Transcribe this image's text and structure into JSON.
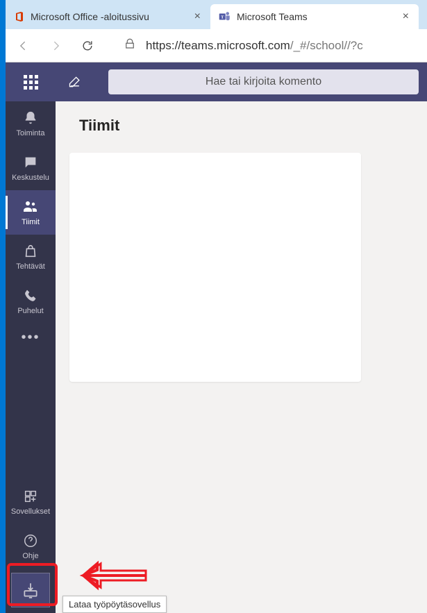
{
  "browser": {
    "tabs": [
      {
        "label": "Microsoft Office -aloitussivu",
        "active": false
      },
      {
        "label": "Microsoft Teams",
        "active": true
      }
    ],
    "url_host": "https://teams.microsoft.com",
    "url_path": "/_#/school//?c"
  },
  "topbar": {
    "search_placeholder": "Hae tai kirjoita komento"
  },
  "rail": {
    "items": [
      {
        "key": "activity",
        "label": "Toiminta"
      },
      {
        "key": "chat",
        "label": "Keskustelu"
      },
      {
        "key": "teams",
        "label": "Tiimit"
      },
      {
        "key": "assignments",
        "label": "Tehtävät"
      },
      {
        "key": "calls",
        "label": "Puhelut"
      }
    ],
    "apps_label": "Sovellukset",
    "help_label": "Ohje"
  },
  "main": {
    "title": "Tiimit"
  },
  "tooltip": {
    "download_desktop": "Lataa työpöytäsovellus"
  }
}
